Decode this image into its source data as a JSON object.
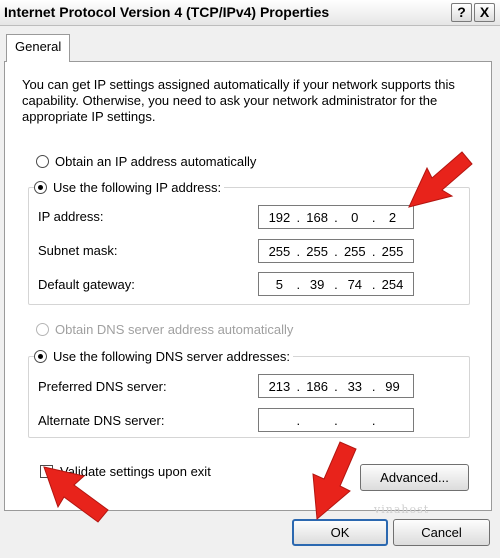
{
  "window": {
    "title": "Internet Protocol Version 4 (TCP/IPv4) Properties",
    "help_label": "?",
    "close_label": "X"
  },
  "tabs": [
    {
      "label": "General"
    }
  ],
  "intro_text": "You can get IP settings assigned automatically if your network supports this capability. Otherwise, you need to ask your network administrator for the appropriate IP settings.",
  "ip_section": {
    "auto_label": "Obtain an IP address automatically",
    "manual_label": "Use the following IP address:",
    "fields": [
      {
        "label": "IP address:",
        "octets": [
          "192",
          "168",
          "0",
          "2"
        ]
      },
      {
        "label": "Subnet mask:",
        "octets": [
          "255",
          "255",
          "255",
          "255"
        ]
      },
      {
        "label": "Default gateway:",
        "octets": [
          "5",
          "39",
          "74",
          "254"
        ]
      }
    ]
  },
  "dns_section": {
    "auto_label": "Obtain DNS server address automatically",
    "manual_label": "Use the following DNS server addresses:",
    "fields": [
      {
        "label": "Preferred DNS server:",
        "octets": [
          "213",
          "186",
          "33",
          "99"
        ]
      },
      {
        "label": "Alternate DNS server:",
        "octets": [
          "",
          "",
          "",
          ""
        ]
      }
    ]
  },
  "validate_label": "Validate settings upon exit",
  "buttons": {
    "advanced": "Advanced...",
    "ok": "OK",
    "cancel": "Cancel"
  },
  "watermark": "vinahost",
  "colors": {
    "arrow": "#e8231b",
    "default_button_border": "#2b68b0"
  }
}
